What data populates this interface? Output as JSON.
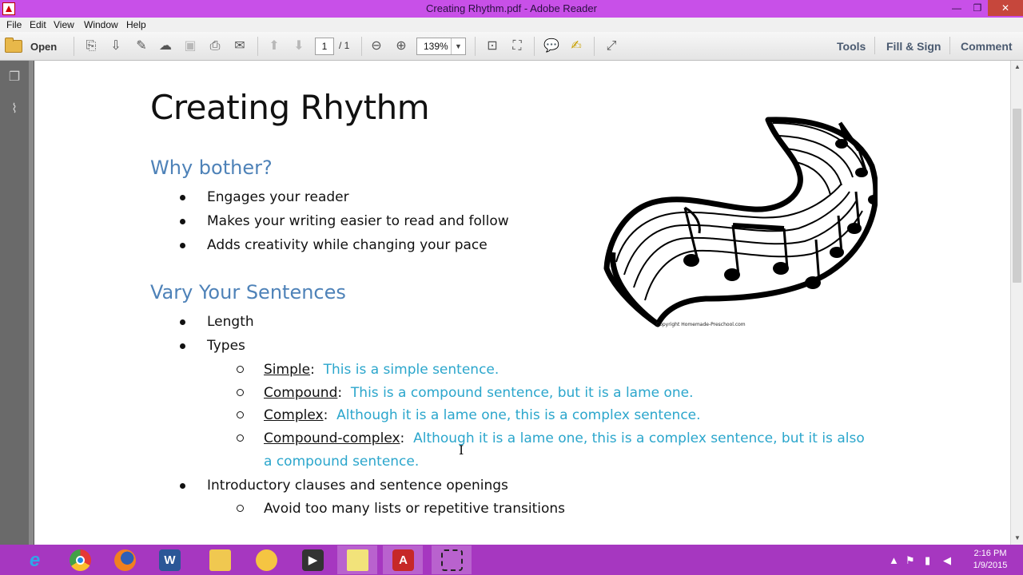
{
  "window": {
    "title": "Creating Rhythm.pdf - Adobe Reader",
    "minimize": "—",
    "maximize": "❐",
    "close": "✕"
  },
  "menu": [
    "File",
    "Edit",
    "View",
    "Window",
    "Help"
  ],
  "toolbar": {
    "open_label": "Open",
    "page_current": "1",
    "page_total": "/ 1",
    "zoom": "139%",
    "tools_label": "Tools",
    "fill_sign_label": "Fill & Sign",
    "comment_label": "Comment"
  },
  "document": {
    "title": "Creating Rhythm",
    "section1": {
      "heading": "Why bother?",
      "bullets": [
        "Engages your reader",
        "Makes your writing easier to read and follow",
        "Adds creativity while changing your pace"
      ]
    },
    "section2": {
      "heading": "Vary Your Sentences",
      "bullets": [
        "Length",
        "Types",
        "Introductory clauses and sentence openings"
      ],
      "types": [
        {
          "term": "Simple",
          "example": "This is a simple sentence."
        },
        {
          "term": "Compound",
          "example": "This is a compound sentence, but it is a lame one."
        },
        {
          "term": "Complex",
          "example": "Although it is a lame one, this is a complex sentence."
        },
        {
          "term": "Compound-complex",
          "example": "Although it is a lame one, this is a complex sentence, but it is also",
          "example_cont": "a compound sentence."
        }
      ],
      "intro_sub": [
        "Avoid too many lists or repetitive transitions"
      ]
    },
    "image_credit": "Copyright Homemade-Preschool.com"
  },
  "taskbar": {
    "clock_time": "2:16 PM",
    "clock_date": "1/9/2015"
  },
  "colors": {
    "accent_purple": "#a637c0",
    "heading_blue": "#4e82b8",
    "example_cyan": "#2ba6cc"
  }
}
